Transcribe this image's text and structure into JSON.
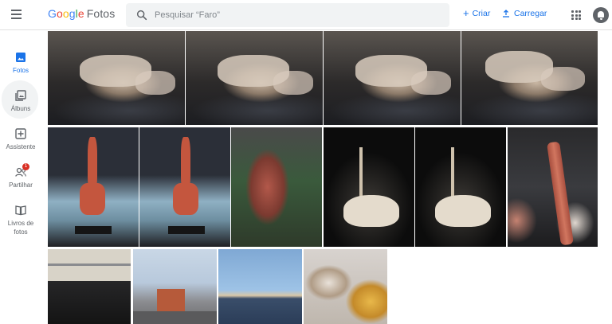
{
  "header": {
    "logo_google": [
      "G",
      "o",
      "o",
      "g",
      "l",
      "e"
    ],
    "logo_product": "Fotos",
    "search_placeholder": "Pesquisar “Faro”",
    "create_label": "Criar",
    "upload_label": "Carregar",
    "icons": {
      "menu": "hamburger-menu-icon",
      "search": "search-icon",
      "create": "plus-icon",
      "upload": "upload-icon",
      "apps": "apps-grid-icon",
      "notifications": "bell-icon"
    }
  },
  "sidebar": {
    "items": [
      {
        "label": "Fotos",
        "icon": "photo-icon",
        "active": true
      },
      {
        "label": "Álbuns",
        "icon": "album-icon",
        "active": false
      },
      {
        "label": "Assistente",
        "icon": "assistant-icon",
        "active": false
      },
      {
        "label": "Partilhar",
        "icon": "sharing-icon",
        "active": false,
        "badge": "1"
      },
      {
        "label": "Livros de fotos",
        "label_lines": [
          "Livros de",
          "fotos"
        ],
        "icon": "photobook-icon",
        "active": false
      }
    ]
  },
  "photos": [
    {
      "subject": "dinosaur skeleton",
      "row": 1
    },
    {
      "subject": "dinosaur skeleton",
      "row": 1
    },
    {
      "subject": "dinosaur skeleton",
      "row": 1
    },
    {
      "subject": "dinosaur skeleton",
      "row": 1
    },
    {
      "subject": "giraffe anatomy exhibit",
      "row": 2
    },
    {
      "subject": "giraffe anatomy exhibit",
      "row": 2
    },
    {
      "subject": "gorilla anatomy exhibit",
      "row": 2
    },
    {
      "subject": "ostrich skeleton",
      "row": 2
    },
    {
      "subject": "ostrich skeleton",
      "row": 2
    },
    {
      "subject": "ostrich neck close-up",
      "row": 2
    },
    {
      "subject": "ostrich skeleton",
      "row": 3
    },
    {
      "subject": "circus tent",
      "row": 3
    },
    {
      "subject": "bay view",
      "row": 3
    },
    {
      "subject": "food",
      "row": 3
    }
  ],
  "colors": {
    "accent": "#1a73e8",
    "badge": "#d93025",
    "search_bg": "#f1f3f4"
  }
}
